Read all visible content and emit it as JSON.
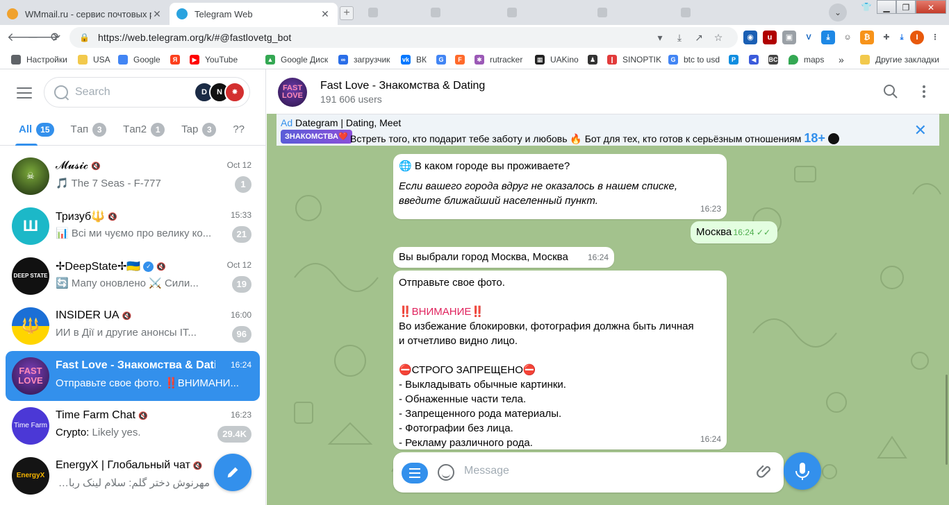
{
  "browser": {
    "tabs": [
      {
        "title": "WMmail.ru - сервис почтовых рассылок",
        "close": "✕",
        "favicon_color": "#f0a22e"
      },
      {
        "title": "Telegram Web",
        "close": "✕",
        "favicon_color": "#2aa3df"
      }
    ],
    "tab_search_icon": "chevron-down-icon",
    "url": "https://web.telegram.org/k/#@fastlovetg_bot",
    "nav": {
      "back": "🡐",
      "forward": "🡒",
      "reload": "⟳"
    },
    "omnibox_actions": [
      "▾",
      "⤓",
      "↗",
      "☆"
    ],
    "window_controls": [
      "▁",
      "❐",
      "✕"
    ],
    "bookmarks": [
      {
        "label": "Настройки",
        "icon": "gear-icon",
        "color": "#5f6368"
      },
      {
        "label": "USA",
        "icon": "folder-icon",
        "color": "#f2c94c"
      },
      {
        "label": "Google",
        "icon": "google-icon",
        "color": "#4285f4"
      },
      {
        "label": "",
        "icon": "yandex-icon",
        "color": "#fc3f1d"
      },
      {
        "label": "YouTube",
        "icon": "youtube-icon",
        "color": "#ff0000"
      },
      {
        "label": "Google Диск",
        "icon": "drive-icon",
        "color": "#34a853"
      },
      {
        "label": "загрузчик",
        "icon": "infinity-icon",
        "color": "#2a6ee8"
      },
      {
        "label": "ВК",
        "icon": "vk-icon",
        "color": "#0077ff"
      },
      {
        "label": "",
        "icon": "translate-icon",
        "color": "#4285f4"
      },
      {
        "label": "",
        "icon": "f-icon",
        "color": "#ff6a2b"
      },
      {
        "label": "rutracker",
        "icon": "rutracker-icon",
        "color": "#9b59b6"
      },
      {
        "label": "UAKino",
        "icon": "film-icon",
        "color": "#222222"
      },
      {
        "label": "",
        "icon": "person-icon",
        "color": "#333333"
      },
      {
        "label": "SINOPTIK",
        "icon": "thermometer-icon",
        "color": "#e23b3b"
      },
      {
        "label": "btc to usd",
        "icon": "google-icon",
        "color": "#4285f4"
      },
      {
        "label": "",
        "icon": "p-icon",
        "color": "#0f8de0"
      },
      {
        "label": "",
        "icon": "arrow-icon",
        "color": "#3b5bdb"
      },
      {
        "label": "",
        "icon": "bc-icon",
        "color": "#444444"
      },
      {
        "label": "maps",
        "icon": "maps-icon",
        "color": "#34a853"
      }
    ],
    "bookmarks_overflow": "»",
    "other_bookmarks": "Другие закладки"
  },
  "sidebar": {
    "search_placeholder": "Search",
    "folders": [
      {
        "label": "All",
        "count": "15",
        "active": true
      },
      {
        "label": "Tап",
        "count": "3",
        "active": false
      },
      {
        "label": "Tап2",
        "count": "1",
        "active": false
      },
      {
        "label": "Tap",
        "count": "3",
        "active": false
      },
      {
        "label": "??",
        "count": "",
        "active": false
      }
    ],
    "chats": [
      {
        "name": "𝓜𝓾𝓼𝓲𝓬",
        "time": "Oct 12",
        "preview": "🎵 The 7 Seas - F-777",
        "badge": "1",
        "muted": true,
        "avatar_color": "#3a5a2a",
        "avatar_text": "",
        "verified": false
      },
      {
        "name": "Тризуб🔱",
        "time": "15:33",
        "preview": "📊 Всі ми чуємо про велику ко...",
        "badge": "21",
        "muted": true,
        "avatar_color": "#1cb8c8",
        "avatar_text": "Ш",
        "verified": false
      },
      {
        "name": "✢DeepState✢🇺🇦",
        "time": "Oct 12",
        "preview": "🔄 Мапу оновлено ⚔️ Сили...",
        "badge": "19",
        "muted": true,
        "avatar_color": "#111111",
        "avatar_text": "DEEP STATE",
        "verified": true
      },
      {
        "name": "INSIDER UA",
        "time": "16:00",
        "preview": "ИИ в Дії и другие анонсы IT...",
        "badge": "96",
        "muted": true,
        "avatar_color": "#1b6fd6",
        "avatar_text": "🔱",
        "verified": false
      },
      {
        "name": "Fast Love - Знакомства & Dating",
        "time": "16:24",
        "preview": "Отправьте свое фото. ‼️ВНИМАНИ...",
        "badge": "",
        "muted": false,
        "avatar_color": "#5b2d8c",
        "avatar_text": "FAST LOVE",
        "verified": false
      },
      {
        "name": "Time Farm Chat",
        "time": "16:23",
        "preview": "Likely yes.",
        "sender": "Crypto:",
        "badge": "29.4K",
        "muted": true,
        "avatar_color": "#4b38d6",
        "avatar_text": "Time Farm",
        "verified": false
      },
      {
        "name": "EnergyX | Глобальный чат",
        "time": "",
        "preview": "مهرنوش دختر گلم: سلام لینک ربات رو میف...",
        "badge": "",
        "muted": true,
        "avatar_color": "#141414",
        "avatar_text": "EnergyX",
        "verified": false
      }
    ],
    "compose_icon": "pencil-icon"
  },
  "chat": {
    "title": "Fast Love - Знакомства & Dating",
    "subtitle": "191 606 users",
    "avatar_text": "FAST LOVE",
    "ad": {
      "label": "Ad",
      "title": "Dategram | Dating, Meet",
      "tag": "ЗНАКОМСТВА❤️",
      "text": "Встреть того, кто подарит тебе заботу и любовь 🔥 Бот для тех, кто готов к серьёзным отношениям",
      "suffix": "18+"
    },
    "messages": [
      {
        "id": "m1",
        "line1": "🌐 В каком городе вы проживаете?",
        "line2": "Если вашего города вдруг не оказалось в нашем списке,",
        "line3": "введите ближайший населенный пункт.",
        "time": "16:23",
        "out": false
      },
      {
        "id": "m2",
        "text": "Москва",
        "time": "16:24",
        "ticks": "✓✓",
        "out": true
      },
      {
        "id": "m3",
        "text": "Вы выбрали город Москва, Москва",
        "time": "16:24",
        "out": false
      },
      {
        "id": "m4",
        "lines": [
          "Отправьте свое фото.",
          "",
          "‼️ВНИМАНИЕ‼️",
          "Во избежание блокировки, фотография должна быть личная",
          "и отчетливо видно лицо.",
          "",
          "⛔СТРОГО ЗАПРЕЩЕНО⛔",
          "- Выкладывать обычные картинки.",
          "- Обнаженные части тела.",
          "- Запрещенного рода материалы.",
          "- Фотографии без лица.",
          "- Рекламу различного рода."
        ],
        "time": "16:24",
        "out": false
      }
    ],
    "composer_placeholder": "Message"
  },
  "colors": {
    "accent": "#3390ec",
    "chat_bg": "#a3c28d",
    "outgoing": "#e3fee0"
  }
}
